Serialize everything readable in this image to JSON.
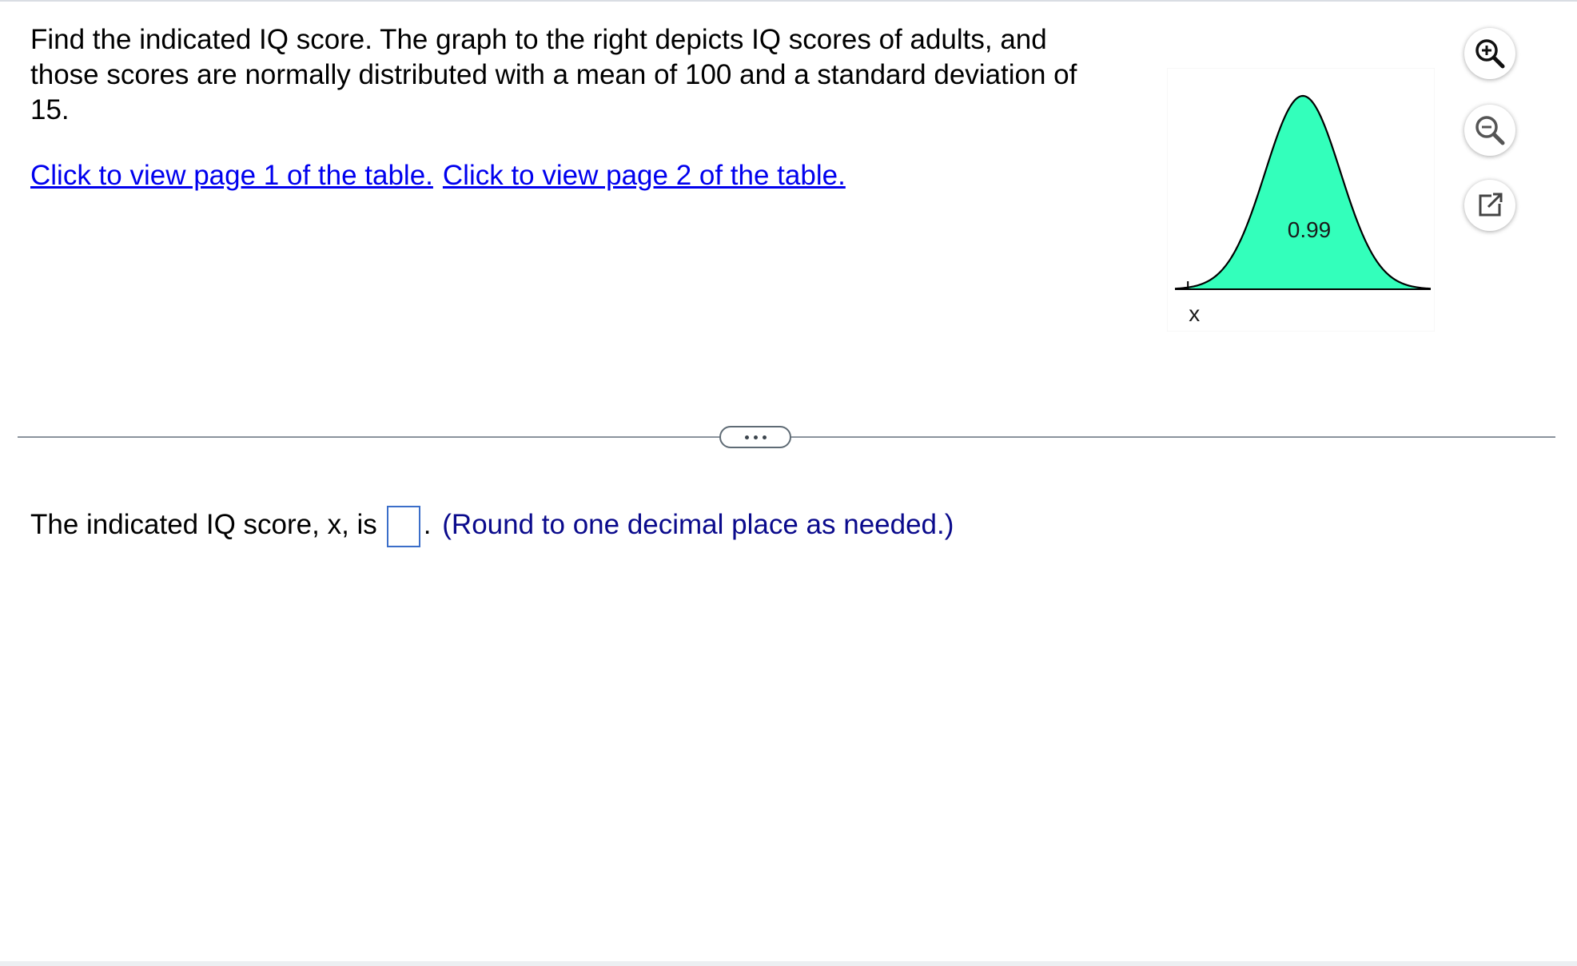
{
  "question": {
    "text": "Find the indicated IQ score. The graph to the right depicts IQ scores of adults, and those scores are normally distributed with a mean of 100 and a standard deviation of 15."
  },
  "links": {
    "page1": "Click to view page 1 of the table.",
    "page2": "Click to view page 2 of the table."
  },
  "graph": {
    "area_label": "0.99",
    "x_label": "x",
    "fill_color": "#33ffbb",
    "curve": {
      "mean": 100,
      "sd": 15,
      "shaded": "right-of-x",
      "shaded_area": 0.99
    }
  },
  "tools": {
    "zoom_in": "zoom-in-icon",
    "zoom_out": "zoom-out-icon",
    "open_external": "external-link-icon"
  },
  "answer": {
    "prefix": "The indicated IQ score, x, is",
    "suffix": ".",
    "note": "(Round to one decimal place as needed.)"
  }
}
